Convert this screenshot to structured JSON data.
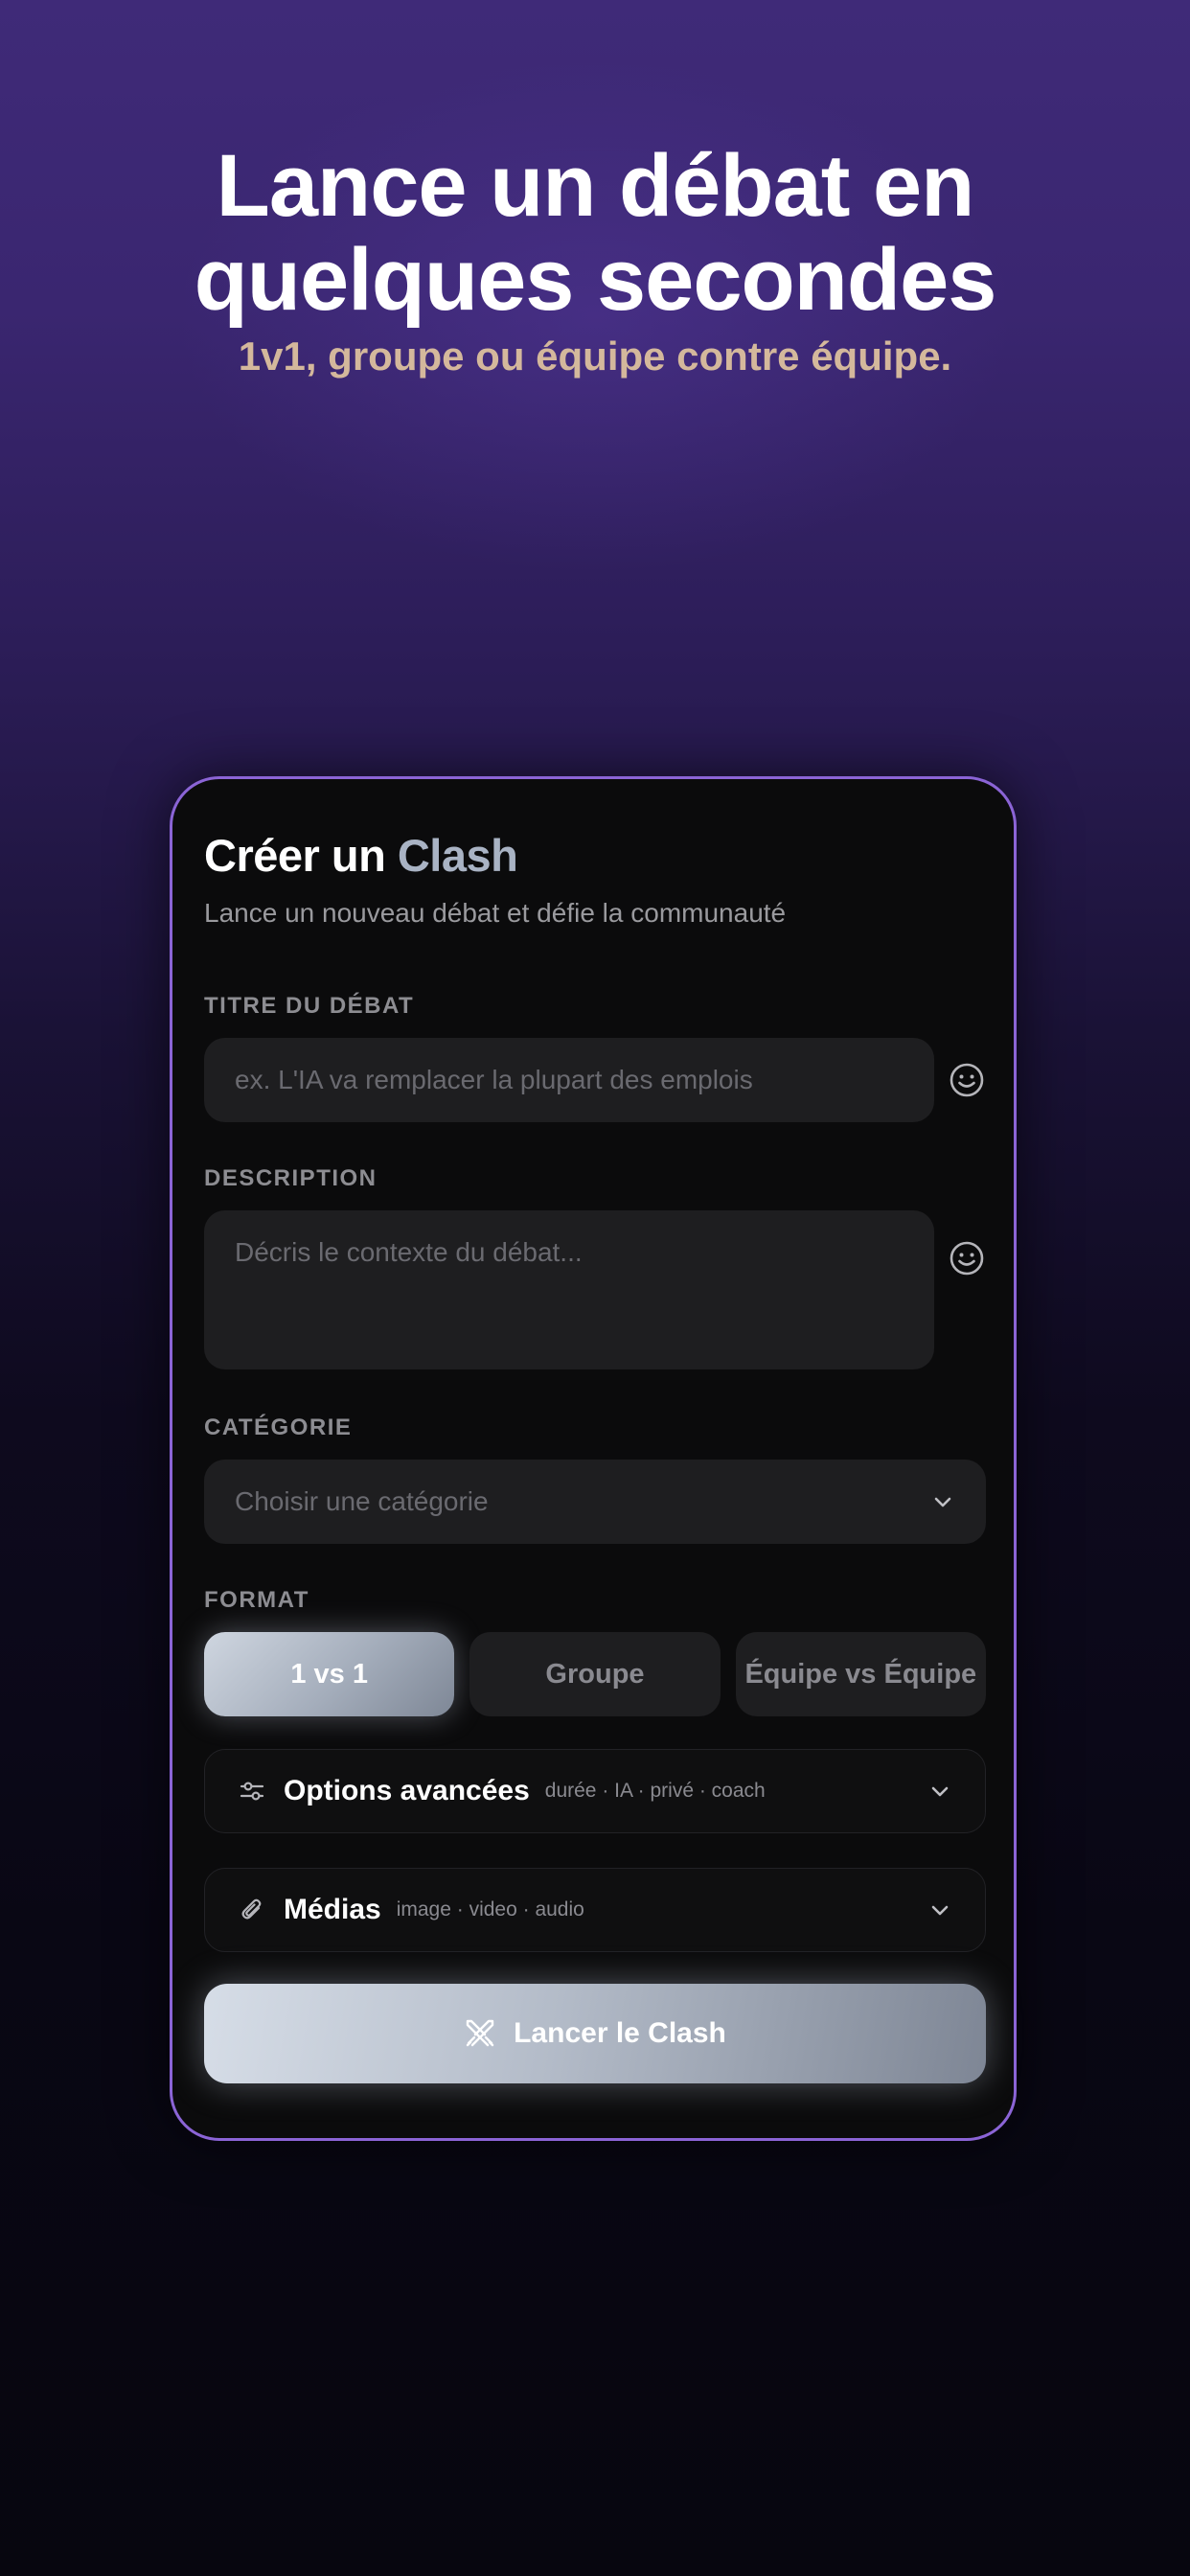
{
  "hero": {
    "title_line1": "Lance un débat en",
    "title_line2": "quelques secondes",
    "subtitle": "1v1, groupe ou équipe contre équipe."
  },
  "card": {
    "title_part1": "Créer un ",
    "title_accent": "Clash",
    "subtitle": "Lance un nouveau débat et défie la communauté"
  },
  "form": {
    "title_label": "TITRE DU DÉBAT",
    "title_placeholder": "ex. L'IA va remplacer la plupart des emplois",
    "title_value": "",
    "description_label": "DESCRIPTION",
    "description_placeholder": "Décris le contexte du débat...",
    "description_value": "",
    "category_label": "CATÉGORIE",
    "category_placeholder": "Choisir une catégorie",
    "format_label": "FORMAT",
    "formats": [
      "1 vs 1",
      "Groupe",
      "Équipe vs Équipe"
    ],
    "selected_format": "1 vs 1"
  },
  "advanced": {
    "title": "Options avancées",
    "hint": "durée · IA · privé · coach"
  },
  "media": {
    "title": "Médias",
    "hint": "image · video · audio"
  },
  "launch": {
    "label": "Lancer le Clash"
  },
  "colors": {
    "card_border": "#8b64d6",
    "hero_subtitle": "#d4b89c",
    "accent": "#a9b3c4",
    "field_bg": "#1e1e20"
  },
  "icons": {
    "emoji": "smiley-icon",
    "chevron": "chevron-down-icon",
    "advanced": "sliders-icon",
    "media": "paperclip-icon",
    "launch": "crossed-swords-icon"
  }
}
